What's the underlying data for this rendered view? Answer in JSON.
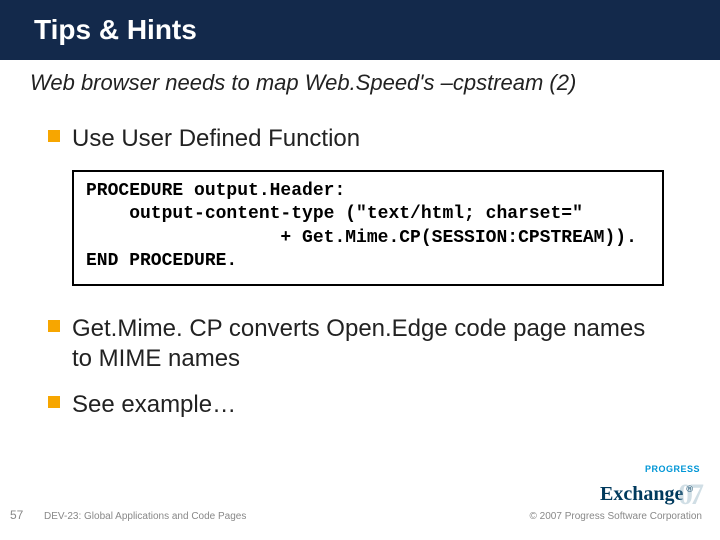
{
  "title": "Tips & Hints",
  "subtitle": "Web browser needs to map Web.Speed's –cpstream (2)",
  "bullets": {
    "b1": "Use User Defined Function",
    "b2": "Get.Mime. CP converts Open.Edge code page names to MIME names",
    "b3": "See example…"
  },
  "code": "PROCEDURE output.Header:\n    output-content-type (\"text/html; charset=\"\n                  + Get.Mime.CP(SESSION:CPSTREAM)).\nEND PROCEDURE.",
  "footer": {
    "page": "57",
    "session": "DEV-23: Global Applications and Code Pages",
    "copyright": "© 2007 Progress Software Corporation"
  },
  "logo": {
    "top": "PROGRESS",
    "main": "Exchange",
    "reg": "®",
    "year": "07"
  }
}
